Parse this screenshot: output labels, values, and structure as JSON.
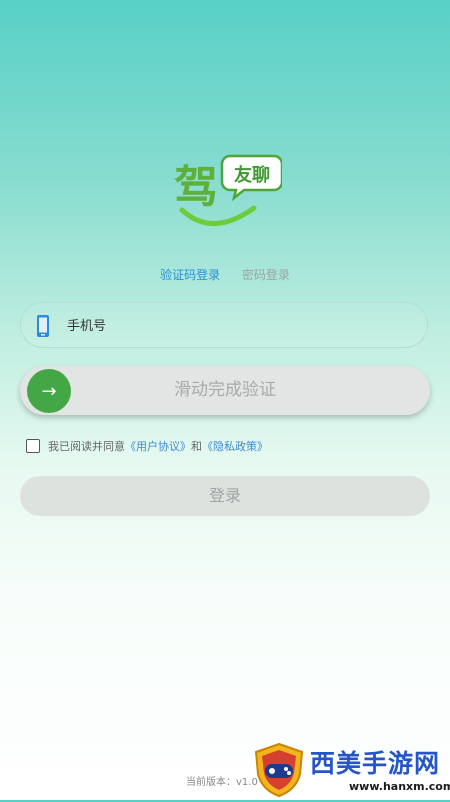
{
  "logo": {
    "text_main": "驾",
    "text_badge": "友聊"
  },
  "tabs": [
    {
      "label": "验证码登录",
      "active": true
    },
    {
      "label": "密码登录",
      "active": false
    }
  ],
  "phone": {
    "placeholder": "手机号",
    "value": ""
  },
  "slider": {
    "label": "滑动完成验证",
    "handle_icon": "→"
  },
  "agreement": {
    "checked": false,
    "prefix": "我已阅读并同意",
    "user_agreement": "《用户协议》",
    "and": "和",
    "privacy_policy": "《隐私政策》"
  },
  "login": {
    "label": "登录"
  },
  "version": {
    "text": "当前版本：v1.0"
  },
  "watermark": {
    "title": "西美手游网",
    "url": "www.hanxm.com"
  },
  "colors": {
    "primary_green": "#43a745",
    "link_blue": "#3e8bd0",
    "tab_active": "#2c8fd6"
  }
}
